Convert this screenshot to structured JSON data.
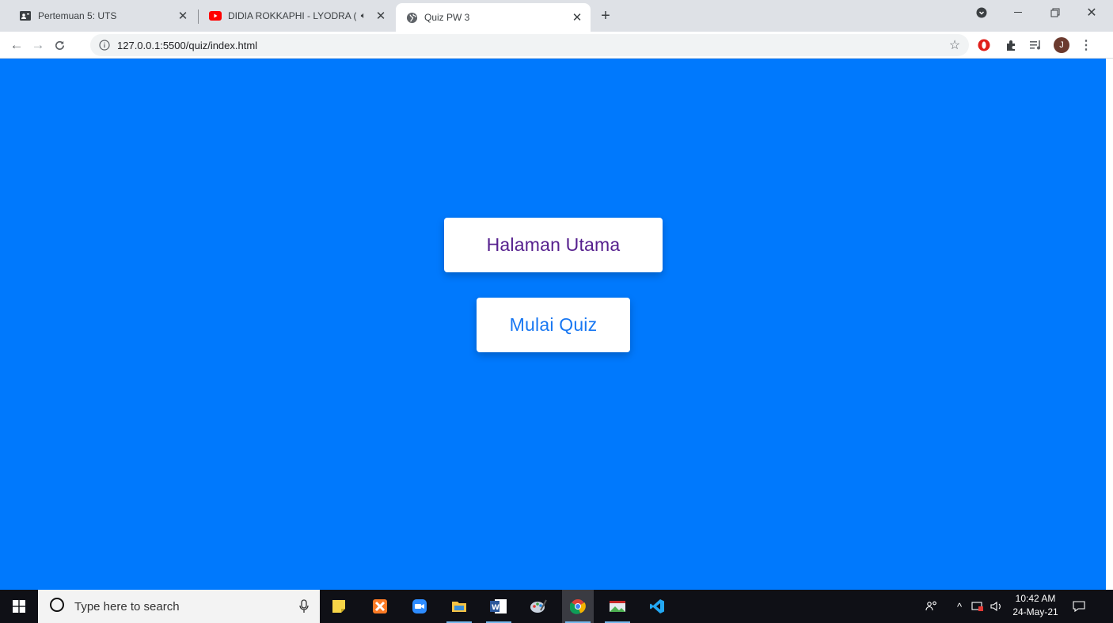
{
  "browser": {
    "tabs": [
      {
        "title": "Pertemuan 5: UTS",
        "favicon": "classroom-icon",
        "active": false
      },
      {
        "title": "DIDIA ROKKAPHI - LYODRA (",
        "favicon": "youtube-icon",
        "audio": "speaker-icon",
        "active": false
      },
      {
        "title": "Quiz PW 3",
        "favicon": "globe-icon",
        "active": true
      }
    ],
    "address": "127.0.0.1:5500/quiz/index.html",
    "profile_initial": "J"
  },
  "page": {
    "background": "#0079fd",
    "buttons": {
      "home_label": "Halaman Utama",
      "home_color": "#56208e",
      "quiz_label": "Mulai Quiz",
      "quiz_color": "#1877f2"
    }
  },
  "taskbar": {
    "search_placeholder": "Type here to search",
    "apps": [
      "sticky-notes-icon",
      "xampp-icon",
      "zoom-icon",
      "file-explorer-icon",
      "word-icon",
      "paint-icon",
      "chrome-icon",
      "media-icon",
      "vscode-icon"
    ],
    "time": "10:42 AM",
    "date": "24-May-21"
  }
}
